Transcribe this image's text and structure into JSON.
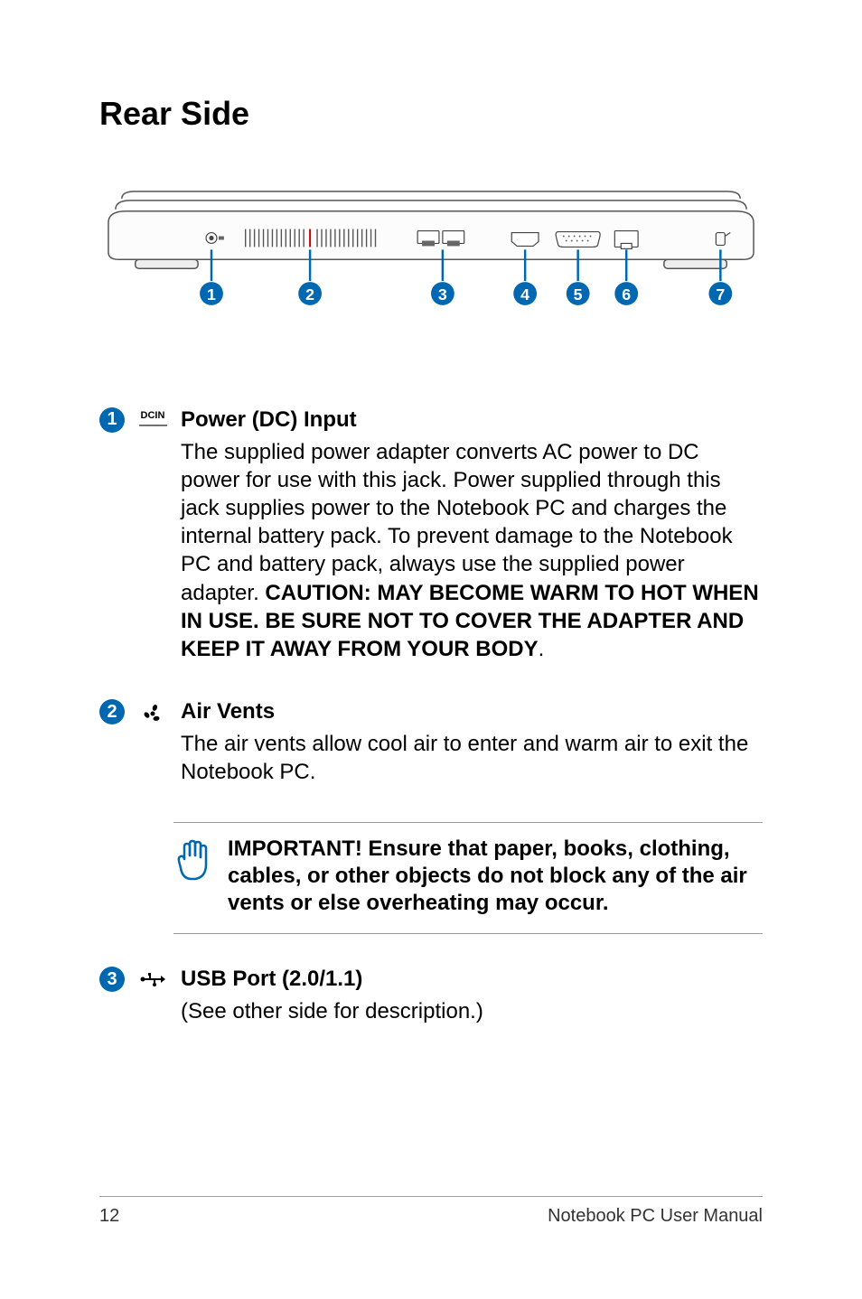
{
  "heading": "Rear Side",
  "callouts": [
    "1",
    "2",
    "3",
    "4",
    "5",
    "6",
    "7"
  ],
  "items": [
    {
      "num": "1",
      "title": "Power (DC) Input",
      "body_pre": "The supplied power adapter converts AC power to DC power for use with this jack. Power supplied through this jack supplies power to the Notebook PC and charges the internal battery pack. To prevent damage to the Notebook PC and battery pack, always use the supplied power adapter. ",
      "caution": "CAUTION: MAY BECOME WARM TO HOT WHEN IN USE. BE SURE NOT TO COVER THE ADAPTER AND KEEP IT AWAY FROM YOUR BODY",
      "body_post": "."
    },
    {
      "num": "2",
      "title": "Air Vents",
      "body": "The air vents allow cool air to enter and warm air to exit the Notebook PC."
    },
    {
      "num": "3",
      "title": "USB Port (2.0/1.1)",
      "body": "(See other side for description.)"
    }
  ],
  "note": "IMPORTANT!  Ensure that paper, books, clothing, cables, or other objects do not block any of the air vents or else overheating may occur.",
  "footer": {
    "page": "12",
    "right": "Notebook PC User Manual"
  },
  "dcin": {
    "top": "DCIN",
    "bottom": "———"
  }
}
